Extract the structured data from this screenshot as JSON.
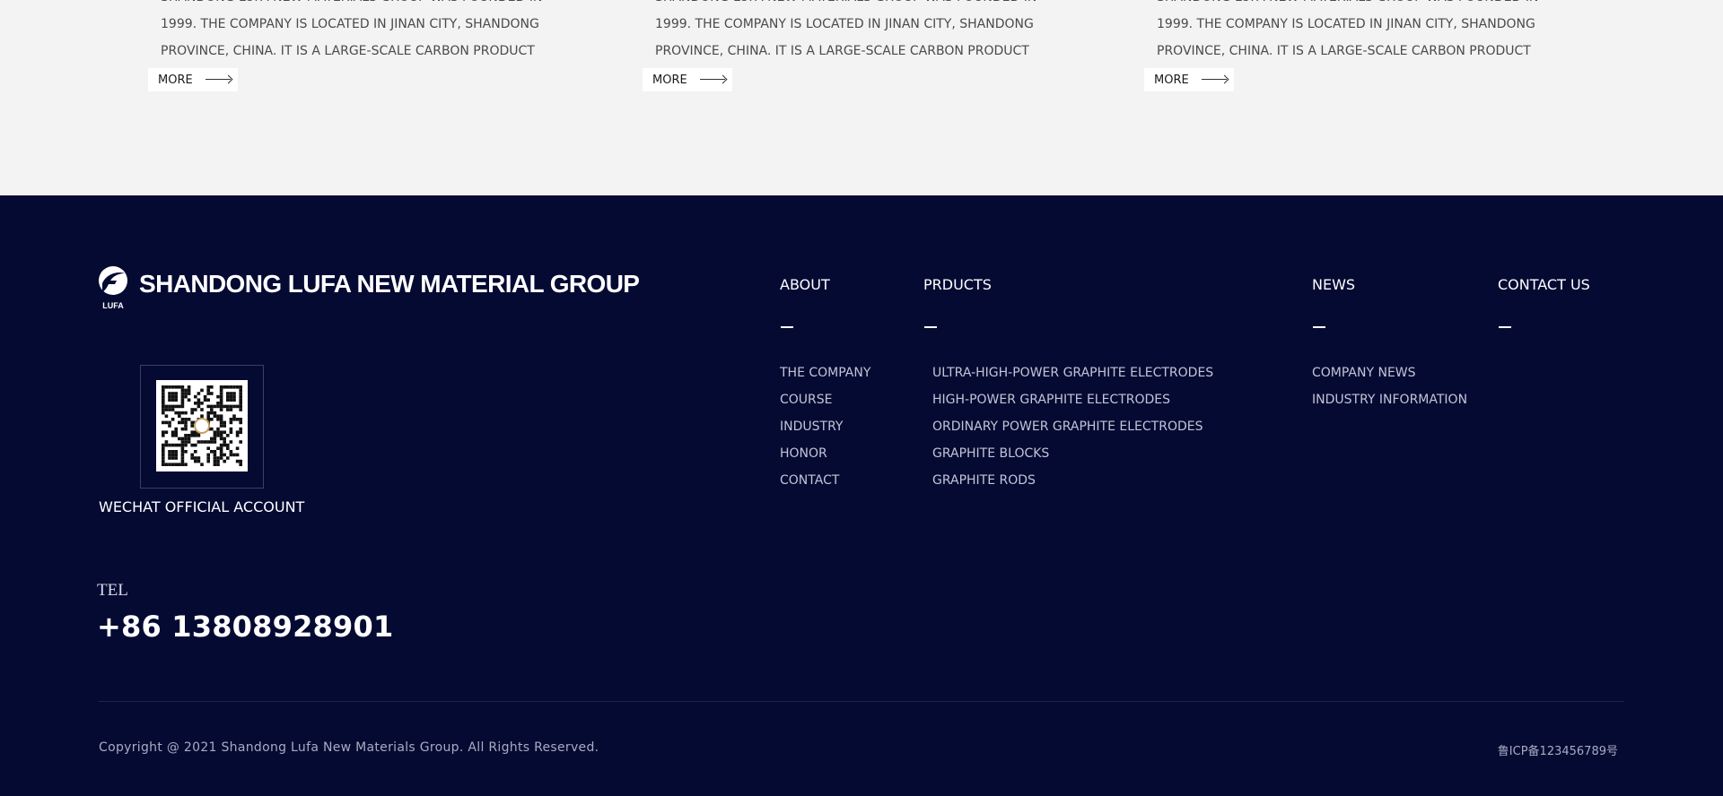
{
  "news": {
    "cards": [
      {
        "excerpt_lines": [
          "SHANDONG LUFA NEW MATERIALS GROUP WAS FOUNDED IN",
          "1999. THE COMPANY IS LOCATED IN JINAN CITY, SHANDONG",
          "PROVINCE, CHINA. IT IS A LARGE-SCALE CARBON PRODUCT"
        ],
        "more_label": "MORE"
      },
      {
        "excerpt_lines": [
          "SHANDONG LUFA NEW MATERIALS GROUP WAS FOUNDED IN",
          "1999. THE COMPANY IS LOCATED IN JINAN CITY, SHANDONG",
          "PROVINCE, CHINA. IT IS A LARGE-SCALE CARBON PRODUCT"
        ],
        "more_label": "MORE"
      },
      {
        "excerpt_lines": [
          "SHANDONG LUFA NEW MATERIALS GROUP WAS FOUNDED IN",
          "1999. THE COMPANY IS LOCATED IN JINAN CITY, SHANDONG",
          "PROVINCE, CHINA. IT IS A LARGE-SCALE CARBON PRODUCT"
        ],
        "more_label": "MORE"
      }
    ]
  },
  "footer": {
    "brand": {
      "logo_text": "LUFA",
      "name": "SHANDONG LUFA NEW MATERIAL GROUP"
    },
    "wechat_label": "WECHAT OFFICIAL ACCOUNT",
    "tel_label": "TEL",
    "tel_number": "+86 13808928901",
    "columns": {
      "about": {
        "title": "ABOUT",
        "links": [
          "THE COMPANY",
          "COURSE",
          "INDUSTRY",
          "HONOR",
          "CONTACT"
        ]
      },
      "products": {
        "title": "PRDUCTS",
        "links": [
          "ULTRA-HIGH-POWER GRAPHITE ELECTRODES",
          "HIGH-POWER GRAPHITE ELECTRODES",
          "ORDINARY POWER GRAPHITE ELECTRODES",
          "GRAPHITE BLOCKS",
          "GRAPHITE RODS"
        ]
      },
      "news": {
        "title": "NEWS",
        "links": [
          "COMPANY NEWS",
          "INDUSTRY INFORMATION"
        ]
      },
      "contact": {
        "title": "CONTACT US",
        "links": []
      }
    },
    "copyright": "Copyright @ 2021 Shandong Lufa New Materials Group. All Rights Reserved.",
    "icp": "鲁ICP备123456789号",
    "colors": {
      "background": "#050a33",
      "page_background": "#f3f3f3",
      "link_text": "#c2c5d6"
    }
  }
}
